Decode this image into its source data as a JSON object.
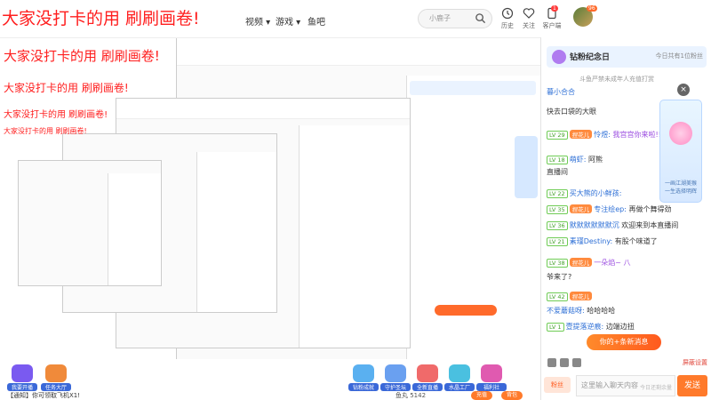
{
  "overlay_title": "大家没打卡的用 刷刷画卷!",
  "nav": {
    "items": [
      "视频",
      "游戏",
      "鱼吧"
    ],
    "search_placeholder": "小鹿子",
    "history_label": "历史",
    "follow_label": "关注",
    "client_label": "客户端",
    "client_badge": "1",
    "avatar_badge": "96"
  },
  "panel": {
    "rank_title": "钻粉纪念日",
    "rank_right": "今日共有1位粉丝",
    "notice": "斗鱼严禁未成年人充值打赏",
    "chat": [
      {
        "lv": "",
        "badge": "",
        "name": "暮小合合",
        "text": ""
      },
      {
        "lv": "",
        "badge": "",
        "name": "快去口袋的大眼",
        "text": ""
      },
      {
        "lv": "LV 29",
        "badge": "捏花儿",
        "name": "怜煜:",
        "text": "我宫宫你来啦!!"
      },
      {
        "lv": "LV 18",
        "badge": "",
        "name": "萌虾:",
        "text": "阿熊"
      },
      {
        "lv": "",
        "badge": "",
        "name": "直播间",
        "text": ""
      },
      {
        "lv": "LV 22",
        "badge": "",
        "name": "买大熊的小鲜孩:",
        "text": ""
      },
      {
        "lv": "LV 35",
        "badge": "捏花儿",
        "name": "专注绘ep:",
        "text": "再做个舞得劲"
      },
      {
        "lv": "LV 36",
        "badge": "",
        "name": "默默默默默默沉",
        "text": "欢迎来到本直播间"
      },
      {
        "lv": "LV 21",
        "badge": "",
        "name": "素瑾Destiny:",
        "text": "有股个味道了"
      },
      {
        "lv": "LV 38",
        "badge": "捏花儿",
        "name": "",
        "text": "一朵焰~ 八"
      },
      {
        "lv": "",
        "badge": "",
        "name": "爷来了?",
        "text": ""
      },
      {
        "lv": "LV 42",
        "badge": "捏花儿",
        "name": "",
        "text": ""
      },
      {
        "lv": "",
        "badge": "",
        "name": "不爱蘑菇呀:",
        "text": "哈哈哈哈"
      },
      {
        "lv": "LV 1",
        "badge": "",
        "name": "壹提落逆痕:",
        "text": "边端边扭"
      }
    ],
    "gift_popup_label": "一画江湖美猴 一生选择明辉",
    "new_msg": "你的+条新消息",
    "input_placeholder": "这里输入聊天内容",
    "input_sub": "今日还剩余量",
    "send": "发送",
    "fan_btn": "粉丝",
    "lock_label": "屏蔽设置"
  },
  "gift_bar": {
    "gifts": [
      {
        "label": "我要开播",
        "color": "#7a5af0"
      },
      {
        "label": "任务大厅",
        "color": "#f08a3a"
      },
      {
        "label": "钻粉成就",
        "color": "#5ab0f0"
      },
      {
        "label": "守护圣坛",
        "color": "#6aa0f0"
      },
      {
        "label": "全新直播",
        "color": "#f06a6a"
      },
      {
        "label": "水晶工厂",
        "color": "#4ac0e0"
      },
      {
        "label": "福利社",
        "color": "#e05ab0"
      }
    ],
    "notice": "【通知】你可领取飞机X1!",
    "bottom_info": "鱼丸 5142",
    "recharge": "充值",
    "other": "背包"
  }
}
